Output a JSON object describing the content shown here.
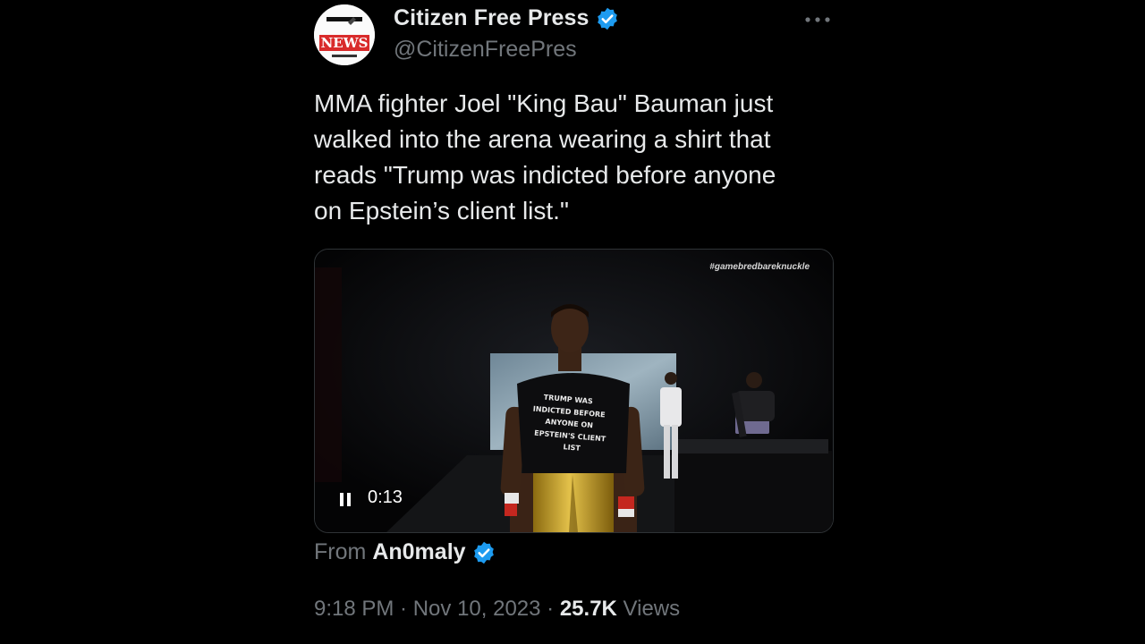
{
  "author": {
    "display_name": "Citizen Free Press",
    "handle": "@CitizenFreePres",
    "avatar_text": "NEWS",
    "verified_color": "#1d9bf0"
  },
  "tweet": {
    "text": "MMA fighter Joel \"King Bau\" Bauman just\nwalked into the arena wearing a shirt that\nreads \"Trump was indicted before anyone\non Epstein’s client list.\""
  },
  "media": {
    "hashtag": "#gamebredbareknuckle",
    "shirt_lines": [
      "TRUMP WAS",
      "INDICTED BEFORE",
      "ANYONE ON",
      "EPSTEIN'S CLIENT",
      "LIST"
    ],
    "time": "0:13",
    "state": "playing"
  },
  "source": {
    "prefix": "From",
    "name": "An0maly"
  },
  "meta": {
    "time": "9:18 PM",
    "separator": " · ",
    "date": "Nov 10, 2023",
    "views_count": "25.7K",
    "views_label": "Views"
  },
  "icons": {
    "verified": "verified-badge-icon",
    "more": "more-options-icon",
    "pause": "pause-icon"
  }
}
